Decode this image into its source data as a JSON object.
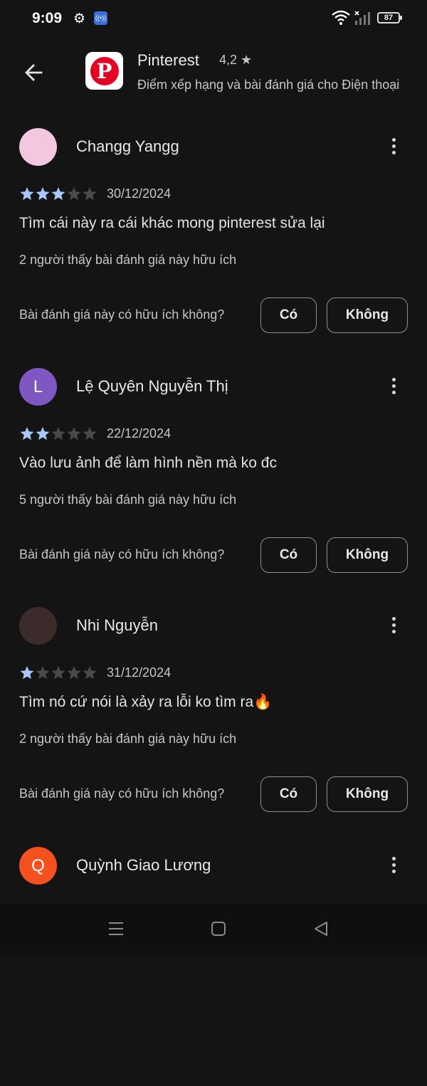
{
  "status_bar": {
    "time": "9:09",
    "battery": "87"
  },
  "header": {
    "app_name": "Pinterest",
    "app_rating": "4,2",
    "subtitle": "Điểm xếp hạng và bài đánh giá cho Điện thoại"
  },
  "colors": {
    "star_filled": "#a8c7fa",
    "star_empty": "#4a4a4a",
    "accent": "#e60023"
  },
  "reviews": [
    {
      "author": "Changg Yangg",
      "avatar_initial": "",
      "avatar_color": "#f4c7e0",
      "rating": 3,
      "date": "30/12/2024",
      "text": "Tìm cái này ra cái khác mong pinterest sửa lại",
      "helpful": "2 người thấy bài đánh giá này hữu ích",
      "question": "Bài đánh giá này có hữu ích không?",
      "yes": "Có",
      "no": "Không"
    },
    {
      "author": "Lệ Quyên Nguyễn Thị",
      "avatar_initial": "L",
      "avatar_color": "#7e57c2",
      "rating": 2,
      "date": "22/12/2024",
      "text": "Vào lưu ảnh để làm hình nền mà ko đc",
      "helpful": "5 người thấy bài đánh giá này hữu ích",
      "question": "Bài đánh giá này có hữu ích không?",
      "yes": "Có",
      "no": "Không"
    },
    {
      "author": "Nhi Nguyễn",
      "avatar_initial": "",
      "avatar_color": "#3b2b2b",
      "rating": 1,
      "date": "31/12/2024",
      "text": "Tìm nó cứ nói là xảy ra lỗi ko tìm ra🔥",
      "helpful": "2 người thấy bài đánh giá này hữu ích",
      "question": "Bài đánh giá này có hữu ích không?",
      "yes": "Có",
      "no": "Không"
    },
    {
      "author": "Quỳnh Giao Lương",
      "avatar_initial": "Q",
      "avatar_color": "#f4511e"
    }
  ]
}
